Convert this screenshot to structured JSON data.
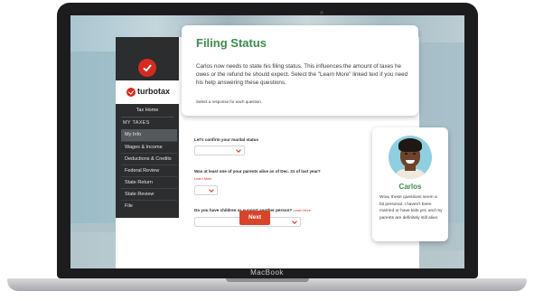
{
  "device": {
    "label": "MacBook"
  },
  "sidebar": {
    "brand": "turbotax",
    "tax_home": "Tax Home",
    "section": "MY TAXES",
    "items": [
      {
        "label": "My Info",
        "active": true
      },
      {
        "label": "Wages & Income"
      },
      {
        "label": "Deductions & Credits"
      },
      {
        "label": "Federal Review"
      },
      {
        "label": "State Return"
      },
      {
        "label": "State Review"
      },
      {
        "label": "File"
      }
    ]
  },
  "card": {
    "title": "Filing Status",
    "body": "Carlos now needs to state his filing status. This influences the amount of taxes he owes or the refund he should expect. Select the \"Learn More\" linked text if you need his help answering these questions.",
    "note": "Select a response for each question."
  },
  "questions": [
    {
      "text": "Let's confirm your marital status"
    },
    {
      "text": "Was at least one of your parents alive as of Dec. 31 of last year?",
      "link": "Learn More"
    },
    {
      "text": "Do you have children or support another person?",
      "link": "Learn More"
    }
  ],
  "next_button": "Next",
  "carlos": {
    "name": "Carlos",
    "text": "Wow, these questions seem a bit personal. I haven't been married or have kids yet, and my parents are definitely still alive."
  },
  "colors": {
    "accent": "#d52b1e",
    "title_green": "#3d8a4e",
    "sidebar_bg": "#2b2d2f"
  }
}
